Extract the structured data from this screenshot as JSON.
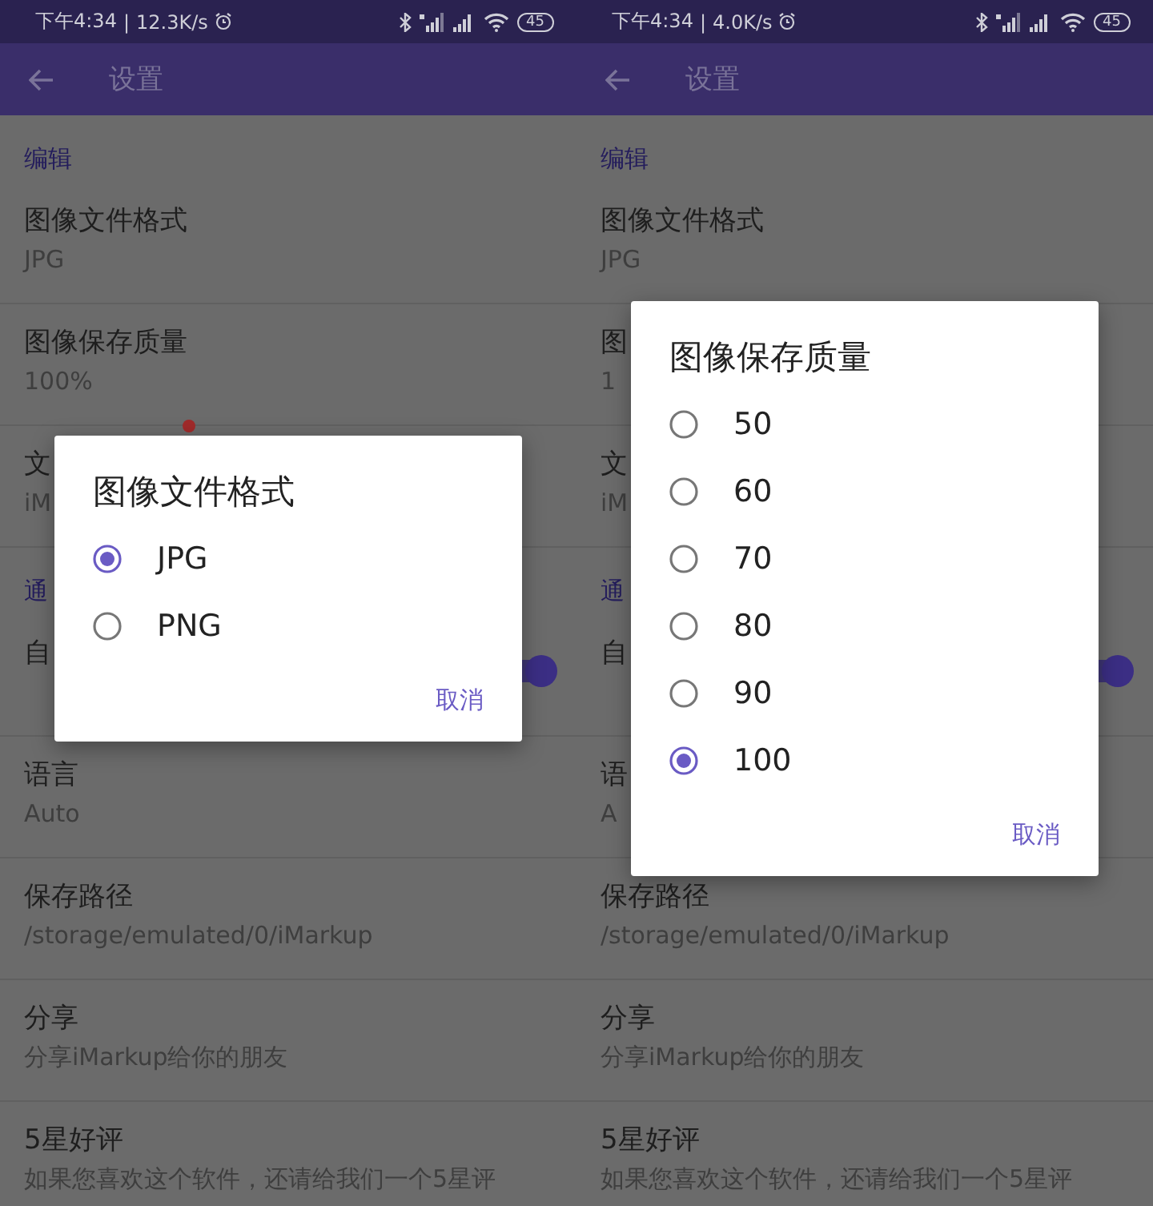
{
  "panels": [
    {
      "status_bar": {
        "time": "下午4:34",
        "separator": "|",
        "speed": "12.3K/s",
        "battery": "45"
      },
      "toolbar": {
        "title": "设置"
      },
      "list": [
        {
          "kind": "section",
          "title": "编辑"
        },
        {
          "kind": "row",
          "title": "图像文件格式",
          "subtitle": "JPG"
        },
        {
          "kind": "row",
          "title": "图像保存质量",
          "subtitle": "100%"
        },
        {
          "kind": "row",
          "title": "文",
          "subtitle": "iM",
          "badge": true
        },
        {
          "kind": "section",
          "title": "通"
        },
        {
          "kind": "row",
          "title": "自",
          "switch_on": true
        },
        {
          "kind": "row",
          "title": "语言",
          "subtitle": "Auto"
        },
        {
          "kind": "row",
          "title": "保存路径",
          "subtitle": "/storage/emulated/0/iMarkup"
        },
        {
          "kind": "row",
          "title": "分享",
          "subtitle": "分享iMarkup给你的朋友"
        },
        {
          "kind": "row",
          "title": "5星好评",
          "subtitle": "如果您喜欢这个软件，还请给我们一个5星评"
        }
      ],
      "dialog": {
        "title": "图像文件格式",
        "options": [
          {
            "label": "JPG",
            "selected": true
          },
          {
            "label": "PNG",
            "selected": false
          }
        ],
        "cancel": "取消"
      }
    },
    {
      "status_bar": {
        "time": "下午4:34",
        "separator": "|",
        "speed": "4.0K/s",
        "battery": "45"
      },
      "toolbar": {
        "title": "设置"
      },
      "list": [
        {
          "kind": "section",
          "title": "编辑"
        },
        {
          "kind": "row",
          "title": "图像文件格式",
          "subtitle": "JPG"
        },
        {
          "kind": "row",
          "title": "图",
          "subtitle": "1"
        },
        {
          "kind": "row",
          "title": "文",
          "subtitle": "iM"
        },
        {
          "kind": "section",
          "title": "通"
        },
        {
          "kind": "row",
          "title": "自",
          "switch_on": true
        },
        {
          "kind": "row",
          "title": "语",
          "subtitle": "A"
        },
        {
          "kind": "row",
          "title": "保存路径",
          "subtitle": "/storage/emulated/0/iMarkup"
        },
        {
          "kind": "row",
          "title": "分享",
          "subtitle": "分享iMarkup给你的朋友"
        },
        {
          "kind": "row",
          "title": "5星好评",
          "subtitle": "如果您喜欢这个软件，还请给我们一个5星评"
        }
      ],
      "dialog": {
        "title": "图像保存质量",
        "options": [
          {
            "label": "50",
            "selected": false
          },
          {
            "label": "60",
            "selected": false
          },
          {
            "label": "70",
            "selected": false
          },
          {
            "label": "80",
            "selected": false
          },
          {
            "label": "90",
            "selected": false
          },
          {
            "label": "100",
            "selected": true
          }
        ],
        "cancel": "取消"
      }
    }
  ]
}
